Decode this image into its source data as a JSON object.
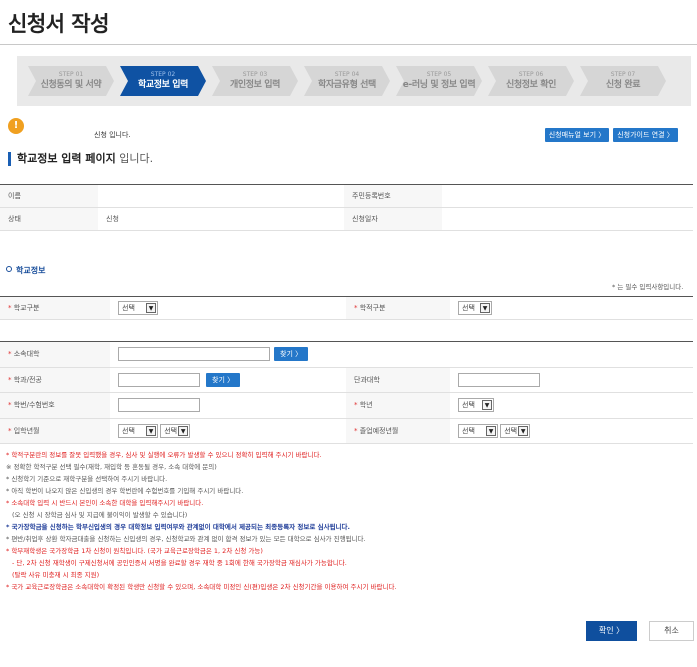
{
  "page": {
    "title": "신청서 작성"
  },
  "steps": [
    {
      "num": "STEP 01",
      "label": "신청동의 및 서약",
      "active": false
    },
    {
      "num": "STEP 02",
      "label": "학교정보 입력",
      "active": true
    },
    {
      "num": "STEP 03",
      "label": "개인정보 입력",
      "active": false
    },
    {
      "num": "STEP 04",
      "label": "학자금유형 선택",
      "active": false
    },
    {
      "num": "STEP 05",
      "label": "e-러닝 및 정보 입력",
      "active": false
    },
    {
      "num": "STEP 06",
      "label": "신청정보 확인",
      "active": false
    },
    {
      "num": "STEP 07",
      "label": "신청 완료",
      "active": false
    }
  ],
  "status": {
    "message": "신청 입니다.",
    "manual_button": "신청매뉴얼 보기 〉",
    "guide_button": "신청가이드 연결 〉"
  },
  "section": {
    "title_bold": "학교정보 입력 페이지",
    "title_rest": " 입니다."
  },
  "applicant": {
    "name_label": "이름",
    "name_value": "",
    "rrn_label": "주민등록번호",
    "rrn_value": "",
    "state_label": "상태",
    "state_value": "신청",
    "date_label": "신청일자",
    "date_value": ""
  },
  "school": {
    "subtitle": "학교정보",
    "required_note": "* 는 필수 입력사항입니다.",
    "school_type_label": "학교구분",
    "academic_type_label": "학적구분",
    "university_label": "소속대학",
    "department_label": "학과/전공",
    "college_label": "단과대학",
    "student_id_label": "학번/수험번호",
    "grade_label": "학년",
    "admission_label": "입학년월",
    "graduation_label": "졸업예정년월",
    "select_label": "선택",
    "search_button": "찾기 〉"
  },
  "notes": [
    {
      "text": "* 학적구분란의 정보를 잘못 입력했을 경우, 심사 및 실행에 오류가 발생할 수 있으니 정확히 입력해 주시기 바랍니다.",
      "style": "red"
    },
    {
      "text": "※ 정확한 학적구분 선택 필수(재학, 재입학 등 혼동될 경우, 소속 대학에 문의)",
      "style": ""
    },
    {
      "text": "* 신청학기 기준으로 재학구분을 선택하여 주시기 바랍니다.",
      "style": ""
    },
    {
      "text": "* 아직 학번이 나오지 않은 신입생의 경우 학번란에 수험번호를 기입해 주시기 바랍니다.",
      "style": ""
    },
    {
      "text": "* 소속대학 입력 시 반드시 본인이 소속한 대학을 입력해주시기 바랍니다.",
      "style": "red"
    },
    {
      "text": "(오 신청 시 장학금 심사 및 지급에 불이익이 발생할 수 있습니다)",
      "style": "ind"
    },
    {
      "text": "* 국가장학금을 신청하는 학부신입생의 경우 대학정보 입력여부와 관계없이 대학에서 제공되는 최종등록자 정보로 심사됩니다.",
      "style": "blue"
    },
    {
      "text": "* 편반/취업후 상환 학자금대출을 신청하는 신입생의 경우, 신청학교와 관계 없이 합격 정보가 있는 모든 대학으로 심사가 진행됩니다.",
      "style": ""
    },
    {
      "text": "* 학부재학생은 국가장학금 1차 신청이 원칙입니다. (국가 교육근로장학금은 1, 2차 신청 가능)",
      "style": "red"
    },
    {
      "text": "- 단, 2차 신청 재학생이 구제신청서에 공인인증서 서명을 완료할 경우 재학 중 1회에 한해 국가장학금 재심사가 가능합니다.",
      "style": "red ind"
    },
    {
      "text": "(탈락 사유 미충재 시 최종 지원)",
      "style": "red ind"
    },
    {
      "text": "* 국가 교육근로장학금은 소속대학이 확정된 학생만 신청할 수 있으며, 소속대학 미정인 신(편)입생은 2차 신청기간을 이용하여 주시기 바랍니다.",
      "style": "red"
    }
  ],
  "actions": {
    "ok": "확인 〉",
    "cancel": "취소"
  },
  "icons": {
    "status": "lightbulb-icon"
  },
  "colors": {
    "primary": "#0f52a3",
    "accent": "#2477c9",
    "warning": "#e02020",
    "notice": "#1f3d99"
  }
}
